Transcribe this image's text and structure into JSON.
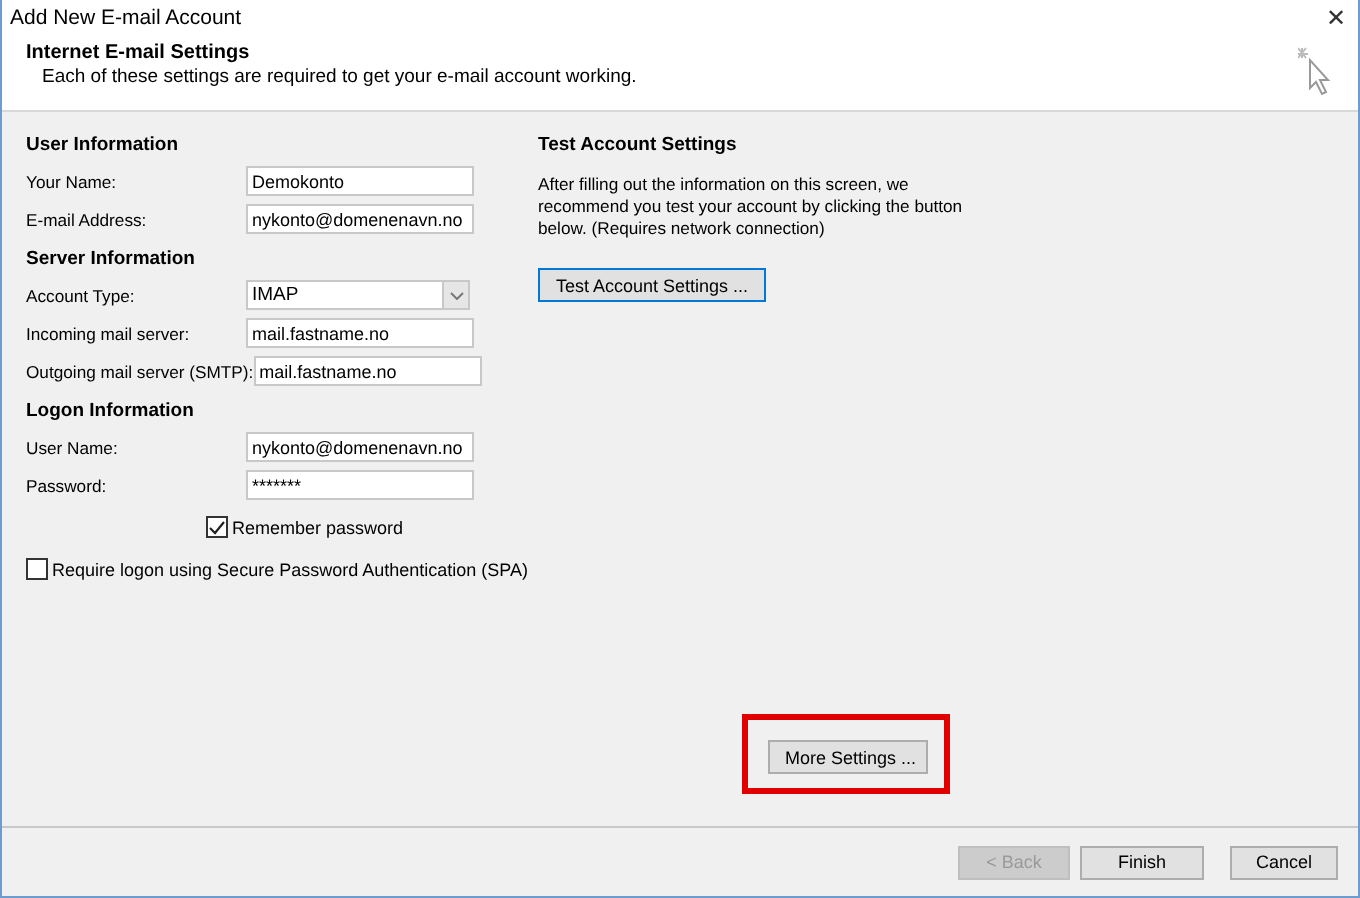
{
  "window": {
    "title": "Add New E-mail Account",
    "close": "✕"
  },
  "header": {
    "title": "Internet E-mail Settings",
    "subtitle": "Each of these settings are required to get your e-mail account working."
  },
  "sections": [
    {
      "title": "User Information",
      "fields": [
        {
          "label": "Your Name:",
          "value": "Demokonto",
          "kind": "text"
        },
        {
          "label": "E-mail Address:",
          "value": "nykonto@domenenavn.no",
          "kind": "text"
        }
      ]
    },
    {
      "title": "Server Information",
      "fields": [
        {
          "label": "Account Type:",
          "value": "IMAP",
          "kind": "select"
        },
        {
          "label": "Incoming mail server:",
          "value": "mail.fastname.no",
          "kind": "text"
        },
        {
          "label": "Outgoing mail server (SMTP):",
          "value": "mail.fastname.no",
          "kind": "text"
        }
      ]
    },
    {
      "title": "Logon Information",
      "fields": [
        {
          "label": "User Name:",
          "value": "nykonto@domenenavn.no",
          "kind": "text"
        },
        {
          "label": "Password:",
          "value": "*******",
          "kind": "password"
        }
      ]
    }
  ],
  "remember_password": {
    "label": "Remember password",
    "checked": true
  },
  "spa": {
    "label": "Require logon using Secure Password Authentication (SPA)",
    "checked": false
  },
  "test": {
    "title": "Test Account Settings",
    "text": "After filling out the information on this screen, we recommend you test your account by clicking the button below. (Requires network connection)",
    "button": "Test Account Settings ..."
  },
  "more_settings": {
    "label": "More Settings ...",
    "highlighted": true
  },
  "footer_buttons": [
    {
      "label": "< Back",
      "disabled": true
    },
    {
      "label": "Finish",
      "disabled": false
    },
    {
      "label": "Cancel",
      "disabled": false
    }
  ]
}
